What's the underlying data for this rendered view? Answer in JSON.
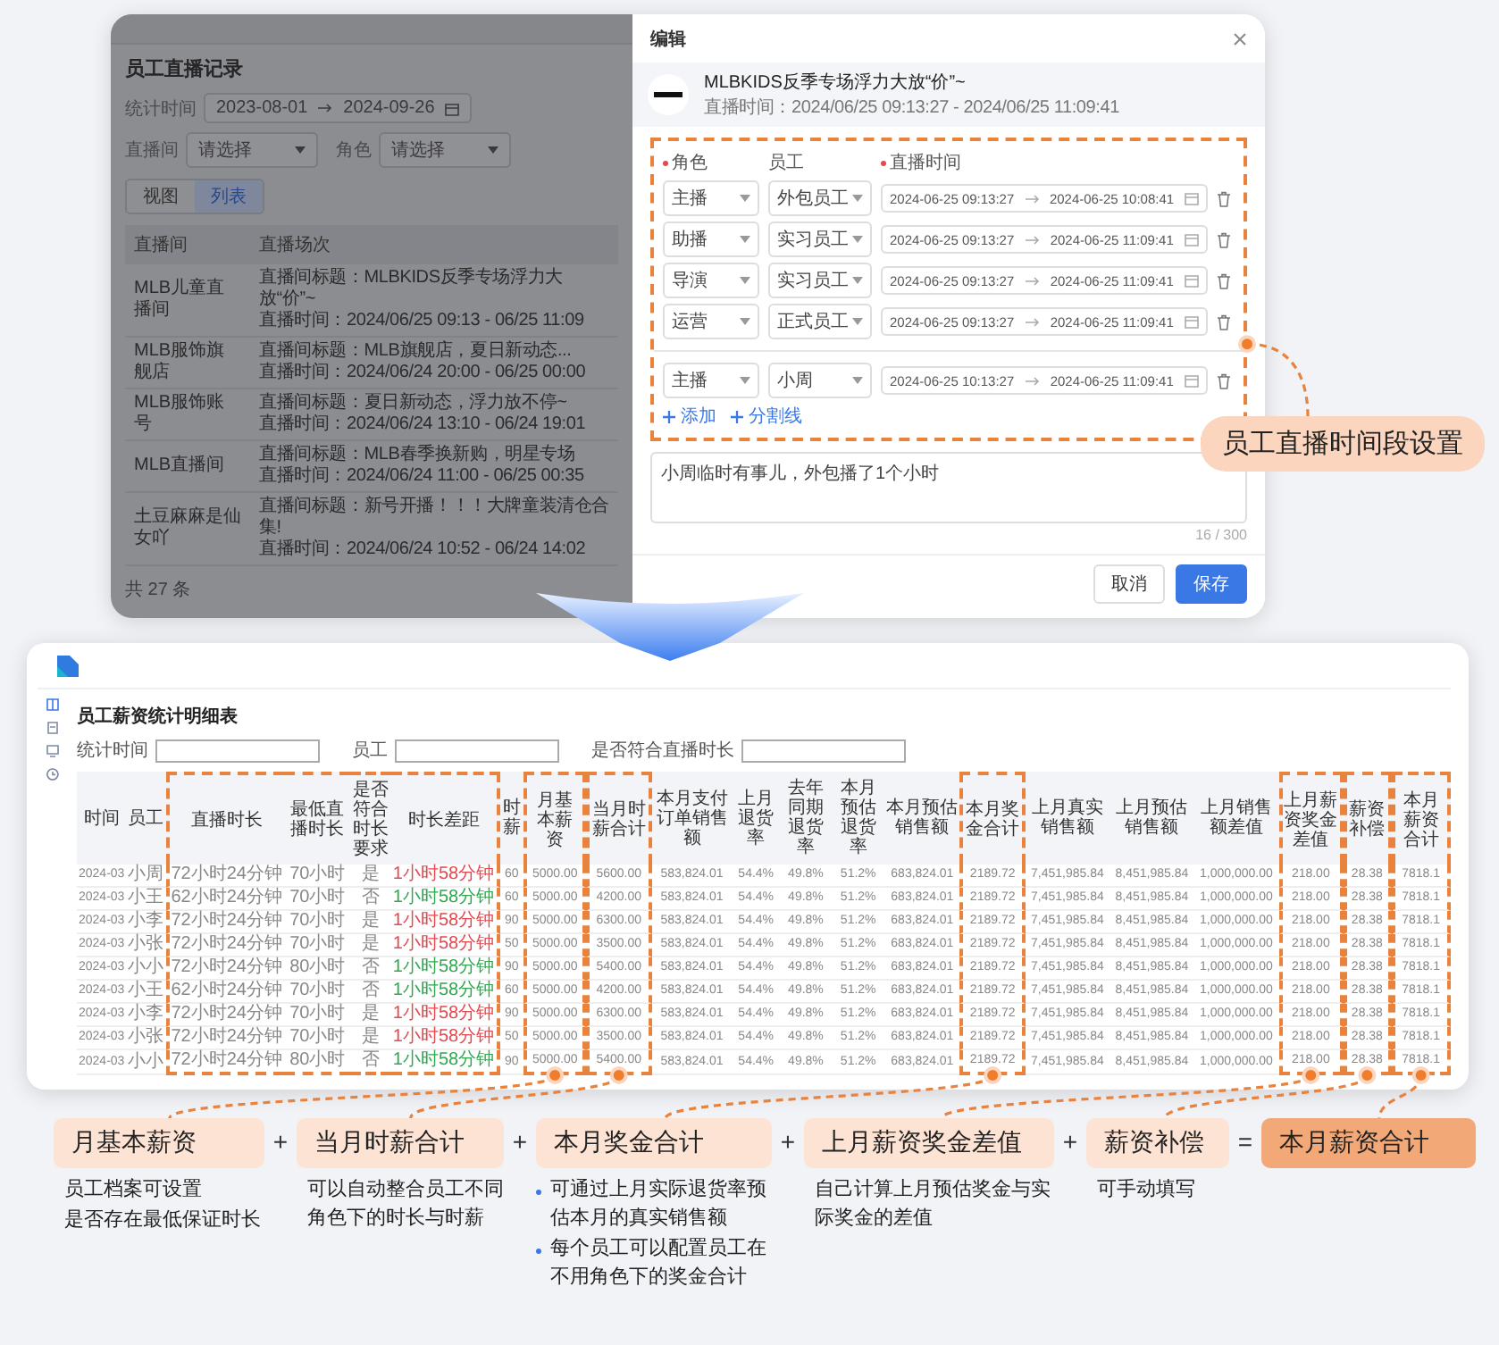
{
  "top_screen": {
    "list_page": {
      "title": "员工直播记录",
      "filters": [
        {
          "label": "统计时间",
          "kind": "date_range",
          "start": "2023-08-01",
          "end": "2024-09-26"
        },
        {
          "label": "直播间",
          "kind": "select",
          "placeholder": "请选择"
        },
        {
          "label": "角色",
          "kind": "select",
          "placeholder": "请选择"
        }
      ],
      "view_tabs": [
        {
          "label": "视图",
          "selected": false
        },
        {
          "label": "列表",
          "selected": true
        }
      ],
      "columns": [
        "直播间",
        "直播场次"
      ],
      "rows": [
        {
          "room": "MLB儿童直播间",
          "title": "直播间标题：MLBKIDS反季专场浮力大放“价”~",
          "time": "直播时间：2024/06/25 09:13 - 06/25 11:09"
        },
        {
          "room": "MLB服饰旗舰店",
          "title": "直播间标题：MLB旗舰店，夏日新动态...",
          "time": "直播时间：2024/06/24 20:00 - 06/25 00:00"
        },
        {
          "room": "MLB服饰账号",
          "title": "直播间标题：夏日新动态，浮力放不停~",
          "time": "直播时间：2024/06/24 13:10 - 06/24 19:01"
        },
        {
          "room": "MLB直播间",
          "title": "直播间标题：MLB春季换新购，明星专场",
          "time": "直播时间：2024/06/24 11:00 - 06/25 00:35"
        },
        {
          "room": "土豆麻麻是仙女吖",
          "title": "直播间标题：新号开播！！！大牌童装清仓合集!",
          "time": "直播时间：2024/06/24 10:52 - 06/24 14:02"
        }
      ],
      "total": "共 27 条"
    },
    "modal": {
      "title": "编辑",
      "session_title": "MLBKIDS反季专场浮力大放“价”~",
      "session_time": "直播时间：2024/06/25 09:13:27 - 2024/06/25 11:09:41",
      "labels": [
        {
          "text": "角色",
          "required": true
        },
        {
          "text": "员工",
          "required": false
        },
        {
          "text": "直播时间",
          "required": true
        }
      ],
      "rows": [
        {
          "kind": "assignment",
          "role": "主播",
          "employee": "外包员工",
          "start": "2024-06-25 09:13:27",
          "end": "2024-06-25 10:08:41"
        },
        {
          "kind": "assignment",
          "role": "助播",
          "employee": "实习员工",
          "start": "2024-06-25 09:13:27",
          "end": "2024-06-25 11:09:41"
        },
        {
          "kind": "assignment",
          "role": "导演",
          "employee": "实习员工",
          "start": "2024-06-25 09:13:27",
          "end": "2024-06-25 11:09:41"
        },
        {
          "kind": "assignment",
          "role": "运营",
          "employee": "正式员工",
          "start": "2024-06-25 09:13:27",
          "end": "2024-06-25 11:09:41"
        },
        {
          "kind": "divider"
        },
        {
          "kind": "assignment",
          "role": "主播",
          "employee": "小周",
          "start": "2024-06-25 10:13:27",
          "end": "2024-06-25 11:09:41"
        }
      ],
      "actions": [
        "添加",
        "分割线"
      ],
      "note": "小周临时有事儿，外包播了1个小时",
      "counter": "16 / 300",
      "buttons": [
        {
          "label": "取消",
          "kind": "secondary"
        },
        {
          "label": "保存",
          "kind": "primary"
        }
      ]
    }
  },
  "callout": "员工直播时间段设置",
  "salary_screen": {
    "title": "员工薪资统计明细表",
    "filters": [
      "统计时间",
      "员工",
      "是否符合直播时长"
    ],
    "columns": [
      {
        "label": "时间",
        "kind": "number",
        "framed": false
      },
      {
        "label": "员工",
        "kind": "text",
        "framed": false
      },
      {
        "label": "直播时长",
        "kind": "text",
        "framed": true,
        "joins_next": true
      },
      {
        "label": "最低直播时长",
        "kind": "text",
        "framed": true,
        "joins_next": true
      },
      {
        "label": "是否符合时长要求",
        "kind": "text",
        "framed": true,
        "joins_next": true
      },
      {
        "label": "时长差距",
        "kind": "gap",
        "framed": true,
        "joins_next": false
      },
      {
        "label": "时薪",
        "kind": "number",
        "framed": false
      },
      {
        "label": "月基本薪资",
        "kind": "number",
        "framed": true,
        "joins_next": false
      },
      {
        "label": "当月时薪合计",
        "kind": "number",
        "framed": true,
        "joins_next": false
      },
      {
        "label": "本月支付订单销售额",
        "kind": "number",
        "framed": false
      },
      {
        "label": "上月退货率",
        "kind": "number",
        "framed": false
      },
      {
        "label": "去年同期退货率",
        "kind": "number",
        "framed": false
      },
      {
        "label": "本月预估退货率",
        "kind": "number",
        "framed": false
      },
      {
        "label": "本月预估销售额",
        "kind": "number",
        "framed": false
      },
      {
        "label": "本月奖金合计",
        "kind": "number",
        "framed": true,
        "joins_next": false
      },
      {
        "label": "上月真实销售额",
        "kind": "number",
        "framed": false
      },
      {
        "label": "上月预估销售额",
        "kind": "number",
        "framed": false
      },
      {
        "label": "上月销售额差值",
        "kind": "number",
        "framed": false
      },
      {
        "label": "上月薪资奖金差值",
        "kind": "number",
        "framed": true,
        "joins_next": false
      },
      {
        "label": "薪资补偿",
        "kind": "number",
        "framed": true,
        "joins_next": false
      },
      {
        "label": "本月薪资合计",
        "kind": "number",
        "framed": true,
        "joins_next": false
      }
    ],
    "rows": [
      {
        "color": "#e5484d",
        "cells": [
          "2024-03",
          "小周",
          "72小时24分钟",
          "70小时",
          "是",
          "1小时58分钟",
          "60",
          "5000.00",
          "5600.00",
          "583,824.01",
          "54.4%",
          "49.8%",
          "51.2%",
          "683,824.01",
          "2189.72",
          "7,451,985.84",
          "8,451,985.84",
          "1,000,000.00",
          "218.00",
          "28.38",
          "7818.1"
        ]
      },
      {
        "color": "#2fa84f",
        "cells": [
          "2024-03",
          "小王",
          "62小时24分钟",
          "70小时",
          "否",
          "1小时58分钟",
          "60",
          "5000.00",
          "4200.00",
          "583,824.01",
          "54.4%",
          "49.8%",
          "51.2%",
          "683,824.01",
          "2189.72",
          "7,451,985.84",
          "8,451,985.84",
          "1,000,000.00",
          "218.00",
          "28.38",
          "7818.1"
        ]
      },
      {
        "color": "#e5484d",
        "cells": [
          "2024-03",
          "小李",
          "72小时24分钟",
          "70小时",
          "是",
          "1小时58分钟",
          "90",
          "5000.00",
          "6300.00",
          "583,824.01",
          "54.4%",
          "49.8%",
          "51.2%",
          "683,824.01",
          "2189.72",
          "7,451,985.84",
          "8,451,985.84",
          "1,000,000.00",
          "218.00",
          "28.38",
          "7818.1"
        ]
      },
      {
        "color": "#e5484d",
        "cells": [
          "2024-03",
          "小张",
          "72小时24分钟",
          "70小时",
          "是",
          "1小时58分钟",
          "50",
          "5000.00",
          "3500.00",
          "583,824.01",
          "54.4%",
          "49.8%",
          "51.2%",
          "683,824.01",
          "2189.72",
          "7,451,985.84",
          "8,451,985.84",
          "1,000,000.00",
          "218.00",
          "28.38",
          "7818.1"
        ]
      },
      {
        "color": "#2fa84f",
        "cells": [
          "2024-03",
          "小小",
          "72小时24分钟",
          "80小时",
          "否",
          "1小时58分钟",
          "90",
          "5000.00",
          "5400.00",
          "583,824.01",
          "54.4%",
          "49.8%",
          "51.2%",
          "683,824.01",
          "2189.72",
          "7,451,985.84",
          "8,451,985.84",
          "1,000,000.00",
          "218.00",
          "28.38",
          "7818.1"
        ]
      },
      {
        "color": "#2fa84f",
        "cells": [
          "2024-03",
          "小王",
          "62小时24分钟",
          "70小时",
          "否",
          "1小时58分钟",
          "60",
          "5000.00",
          "4200.00",
          "583,824.01",
          "54.4%",
          "49.8%",
          "51.2%",
          "683,824.01",
          "2189.72",
          "7,451,985.84",
          "8,451,985.84",
          "1,000,000.00",
          "218.00",
          "28.38",
          "7818.1"
        ]
      },
      {
        "color": "#e5484d",
        "cells": [
          "2024-03",
          "小李",
          "72小时24分钟",
          "70小时",
          "是",
          "1小时58分钟",
          "90",
          "5000.00",
          "6300.00",
          "583,824.01",
          "54.4%",
          "49.8%",
          "51.2%",
          "683,824.01",
          "2189.72",
          "7,451,985.84",
          "8,451,985.84",
          "1,000,000.00",
          "218.00",
          "28.38",
          "7818.1"
        ]
      },
      {
        "color": "#e5484d",
        "cells": [
          "2024-03",
          "小张",
          "72小时24分钟",
          "70小时",
          "是",
          "1小时58分钟",
          "50",
          "5000.00",
          "3500.00",
          "583,824.01",
          "54.4%",
          "49.8%",
          "51.2%",
          "683,824.01",
          "2189.72",
          "7,451,985.84",
          "8,451,985.84",
          "1,000,000.00",
          "218.00",
          "28.38",
          "7818.1"
        ]
      },
      {
        "color": "#2fa84f",
        "cells": [
          "2024-03",
          "小小",
          "72小时24分钟",
          "80小时",
          "否",
          "1小时58分钟",
          "90",
          "5000.00",
          "5400.00",
          "583,824.01",
          "54.4%",
          "49.8%",
          "51.2%",
          "683,824.01",
          "2189.72",
          "7,451,985.84",
          "8,451,985.84",
          "1,000,000.00",
          "218.00",
          "28.38",
          "7818.1"
        ]
      }
    ]
  },
  "formula": [
    {
      "kind": "term",
      "label": "月基本薪资",
      "bulleted": false,
      "notes": [
        "员工档案可设置",
        "是否存在最低保证时长"
      ]
    },
    {
      "kind": "operator",
      "label": "+"
    },
    {
      "kind": "term",
      "label": "当月时薪合计",
      "bulleted": false,
      "notes": [
        "可以自动整合员工不同角色下的时长与时薪"
      ]
    },
    {
      "kind": "operator",
      "label": "+"
    },
    {
      "kind": "term",
      "label": "本月奖金合计",
      "bulleted": true,
      "notes": [
        "可通过上月实际退货率预估本月的真实销售额",
        "每个员工可以配置员工在不用角色下的奖金合计"
      ]
    },
    {
      "kind": "operator",
      "label": "+"
    },
    {
      "kind": "term",
      "label": "上月薪资奖金差值",
      "bulleted": false,
      "notes": [
        "自己计算上月预估奖金与实际奖金的差值"
      ]
    },
    {
      "kind": "operator",
      "label": "+"
    },
    {
      "kind": "term",
      "label": "薪资补偿",
      "bulleted": false,
      "notes": [
        "可手动填写"
      ]
    },
    {
      "kind": "operator",
      "label": "="
    },
    {
      "kind": "result",
      "label": "本月薪资合计"
    }
  ]
}
